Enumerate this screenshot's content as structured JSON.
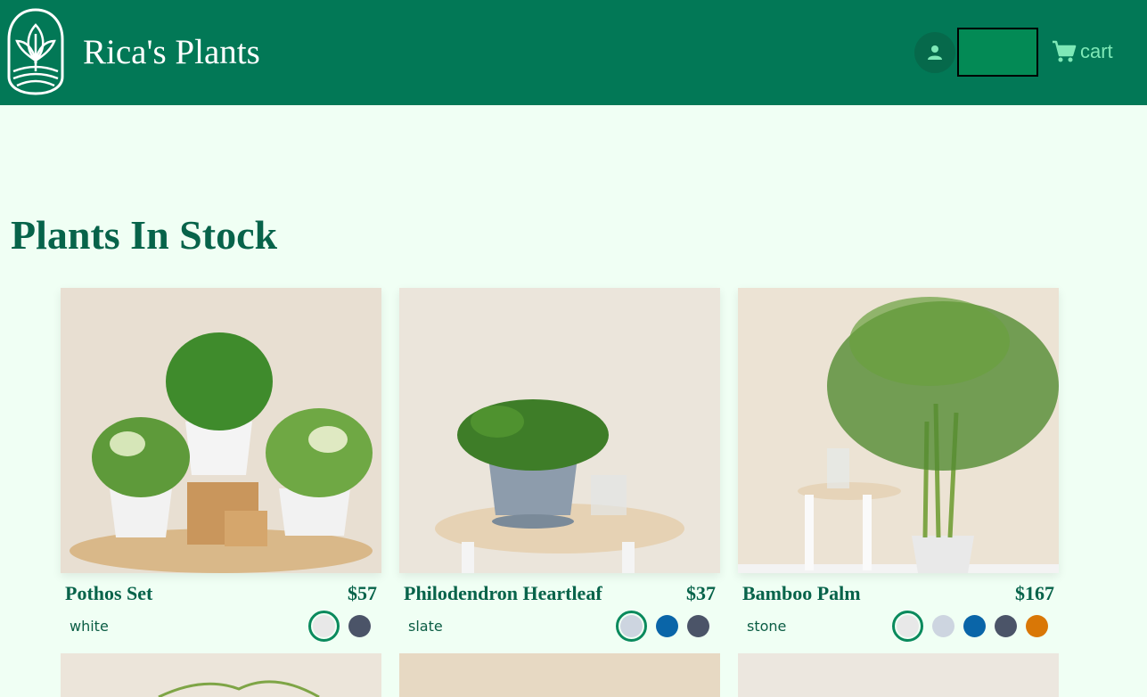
{
  "header": {
    "brand": "Rica's Plants",
    "cart_label": "cart"
  },
  "colors": {
    "header_bg": "#027856",
    "page_bg": "#f0fff4",
    "accent": "#0a8a5d",
    "white": "#e8e8e8",
    "slate": "#cdd5e0",
    "blue": "#0a65a8",
    "gray": "#4b5468",
    "orange": "#d97706"
  },
  "main": {
    "title": "Plants In Stock",
    "products": [
      {
        "name": "Pothos Set",
        "price": "$57",
        "color_name": "white",
        "swatches": [
          "white",
          "gray"
        ],
        "selected": 0
      },
      {
        "name": "Philodendron Heartleaf",
        "price": "$37",
        "color_name": "slate",
        "swatches": [
          "slate",
          "blue",
          "gray"
        ],
        "selected": 0
      },
      {
        "name": "Bamboo Palm",
        "price": "$167",
        "color_name": "stone",
        "swatches": [
          "white",
          "slate",
          "blue",
          "gray",
          "orange"
        ],
        "selected": 0
      }
    ]
  }
}
